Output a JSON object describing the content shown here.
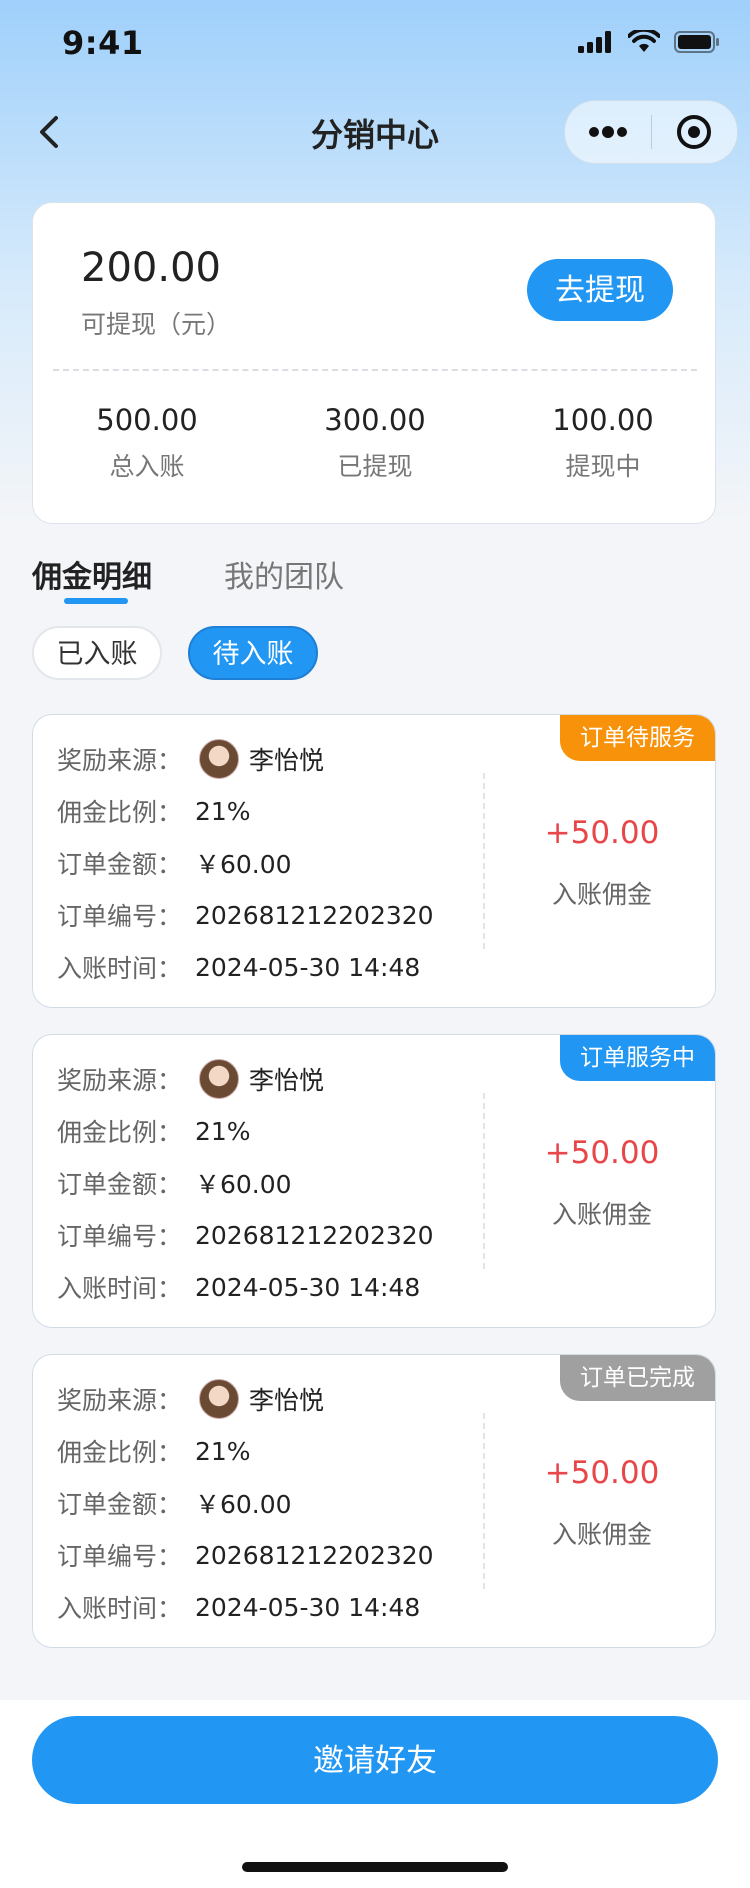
{
  "status_bar": {
    "time": "9:41"
  },
  "nav": {
    "title": "分销中心"
  },
  "summary": {
    "available_amount": "200.00",
    "available_label": "可提现（元）",
    "withdraw_label": "去提现",
    "stats": [
      {
        "value": "500.00",
        "label": "总入账"
      },
      {
        "value": "300.00",
        "label": "已提现"
      },
      {
        "value": "100.00",
        "label": "提现中"
      }
    ]
  },
  "tabs": [
    {
      "label": "佣金明细",
      "active": true
    },
    {
      "label": "我的团队",
      "active": false
    }
  ],
  "filters": [
    {
      "label": "已入账",
      "active": false
    },
    {
      "label": "待入账",
      "active": true
    }
  ],
  "field_labels": {
    "source": "奖励来源：",
    "ratio": "佣金比例：",
    "order_amount": "订单金额：",
    "order_no": "订单编号：",
    "time": "入账时间："
  },
  "cards": [
    {
      "badge": "订单待服务",
      "badge_color": "#F7920A",
      "source_name": "李怡悦",
      "ratio": "21%",
      "order_amount": "￥60.00",
      "order_no": "202681212202320",
      "time": "2024-05-30 14:48",
      "amount": "+50.00",
      "amount_label": "入账佣金"
    },
    {
      "badge": "订单服务中",
      "badge_color": "#2196F3",
      "source_name": "李怡悦",
      "ratio": "21%",
      "order_amount": "￥60.00",
      "order_no": "202681212202320",
      "time": "2024-05-30 14:48",
      "amount": "+50.00",
      "amount_label": "入账佣金"
    },
    {
      "badge": "订单已完成",
      "badge_color": "#A0A0A0",
      "source_name": "李怡悦",
      "ratio": "21%",
      "order_amount": "￥60.00",
      "order_no": "202681212202320",
      "time": "2024-05-30 14:48",
      "amount": "+50.00",
      "amount_label": "入账佣金"
    }
  ],
  "invite_label": "邀请好友",
  "colors": {
    "primary": "#2196F3",
    "amount_red": "#E8474A"
  }
}
